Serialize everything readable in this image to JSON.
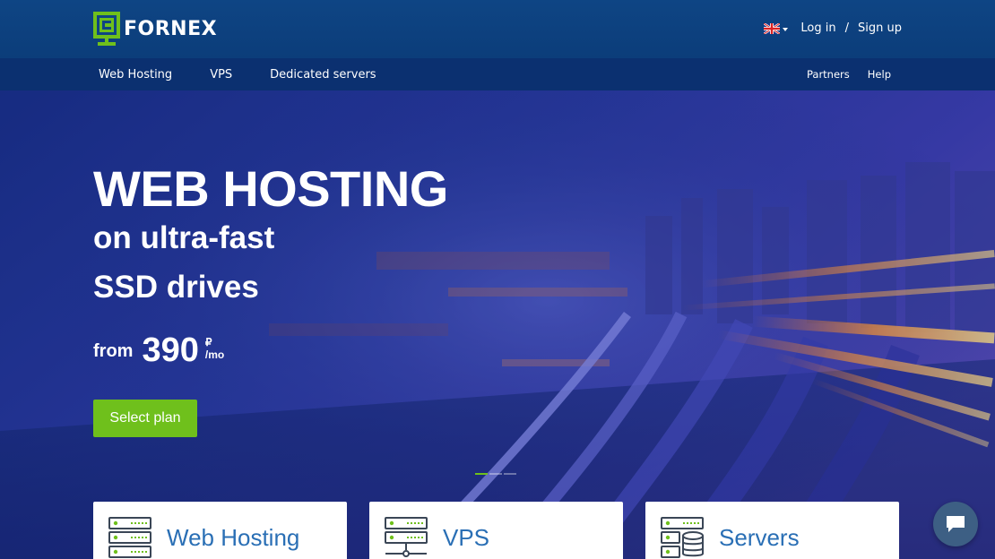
{
  "brand": {
    "name": "FORNEX"
  },
  "header": {
    "login_label": "Log in",
    "separator": "/",
    "signup_label": "Sign up",
    "language_icon": "uk-flag-icon"
  },
  "nav": {
    "left": [
      {
        "label": "Web Hosting"
      },
      {
        "label": "VPS"
      },
      {
        "label": "Dedicated servers"
      }
    ],
    "right": [
      {
        "label": "Partners"
      },
      {
        "label": "Help"
      }
    ]
  },
  "hero": {
    "title": "WEB HOSTING",
    "subtitle_line1": "on ultra-fast",
    "subtitle_line2": "SSD drives",
    "price_prefix": "from",
    "price_amount": "390",
    "price_currency": "₽",
    "price_period": "/mo",
    "cta_label": "Select plan",
    "slides": {
      "count": 3,
      "active_index": 0
    }
  },
  "cards": [
    {
      "title": "Web Hosting",
      "icon": "server-rack-icon"
    },
    {
      "title": "VPS",
      "icon": "server-network-icon"
    },
    {
      "title": "Servers",
      "icon": "server-database-icon"
    }
  ],
  "colors": {
    "header_bg": "#0e4584",
    "nav_bg": "#0b3070",
    "accent_green": "#6fc01c",
    "card_title_blue": "#2a6fb5",
    "chat_bg": "#3d5f84"
  }
}
